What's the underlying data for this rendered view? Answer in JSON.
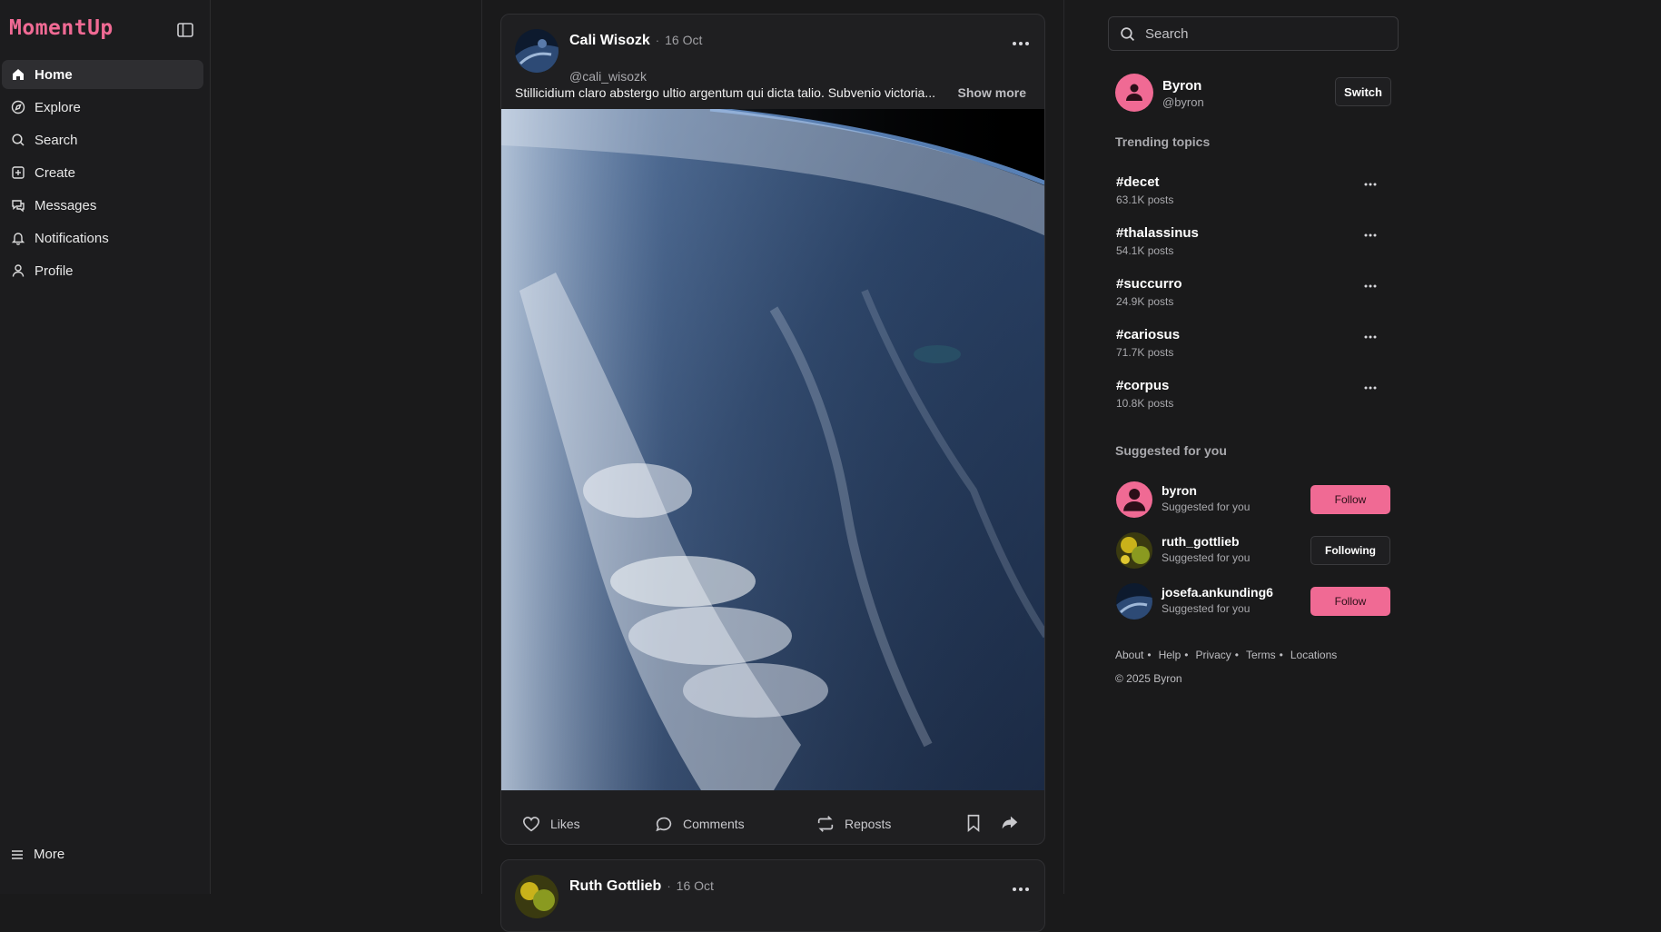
{
  "app": {
    "logo": "MomentUp"
  },
  "sidebar": {
    "items": [
      {
        "label": "Home",
        "icon": "home-icon",
        "active": true
      },
      {
        "label": "Explore",
        "icon": "compass-icon"
      },
      {
        "label": "Search",
        "icon": "search-icon"
      },
      {
        "label": "Create",
        "icon": "plus-square-icon"
      },
      {
        "label": "Messages",
        "icon": "chat-icon"
      },
      {
        "label": "Notifications",
        "icon": "bell-icon"
      },
      {
        "label": "Profile",
        "icon": "user-icon"
      }
    ],
    "more_label": "More"
  },
  "feed": {
    "posts": [
      {
        "author": "Cali Wisozk",
        "date": "16 Oct",
        "handle": "@cali_wisozk",
        "text": "Stillicidium claro abstergo ultio argentum qui dicta talio. Subvenio victoria...",
        "show_more": "Show more",
        "actions": {
          "likes": "Likes",
          "comments": "Comments",
          "reposts": "Reposts"
        }
      },
      {
        "author": "Ruth Gottlieb",
        "date": "16 Oct"
      }
    ]
  },
  "right": {
    "search_placeholder": "Search",
    "me": {
      "name": "Byron",
      "handle": "@byron",
      "switch_label": "Switch"
    },
    "trending_title": "Trending topics",
    "trends": [
      {
        "tag": "#decet",
        "count": "63.1K posts"
      },
      {
        "tag": "#thalassinus",
        "count": "54.1K posts"
      },
      {
        "tag": "#succurro",
        "count": "24.9K posts"
      },
      {
        "tag": "#cariosus",
        "count": "71.7K posts"
      },
      {
        "tag": "#corpus",
        "count": "10.8K posts"
      }
    ],
    "suggested_title": "Suggested for you",
    "suggestions": [
      {
        "name": "byron",
        "sub": "Suggested for you",
        "button": "Follow"
      },
      {
        "name": "ruth_gottlieb",
        "sub": "Suggested for you",
        "button": "Following"
      },
      {
        "name": "josefa.ankunding6",
        "sub": "Suggested for you",
        "button": "Follow"
      }
    ],
    "footer": {
      "links": [
        "About",
        "Help",
        "Privacy",
        "Terms",
        "Locations"
      ],
      "copyright": "© 2025 Byron"
    }
  },
  "colors": {
    "accent": "#f06a94",
    "background": "#1a1a1b",
    "card": "#1f1f21"
  }
}
